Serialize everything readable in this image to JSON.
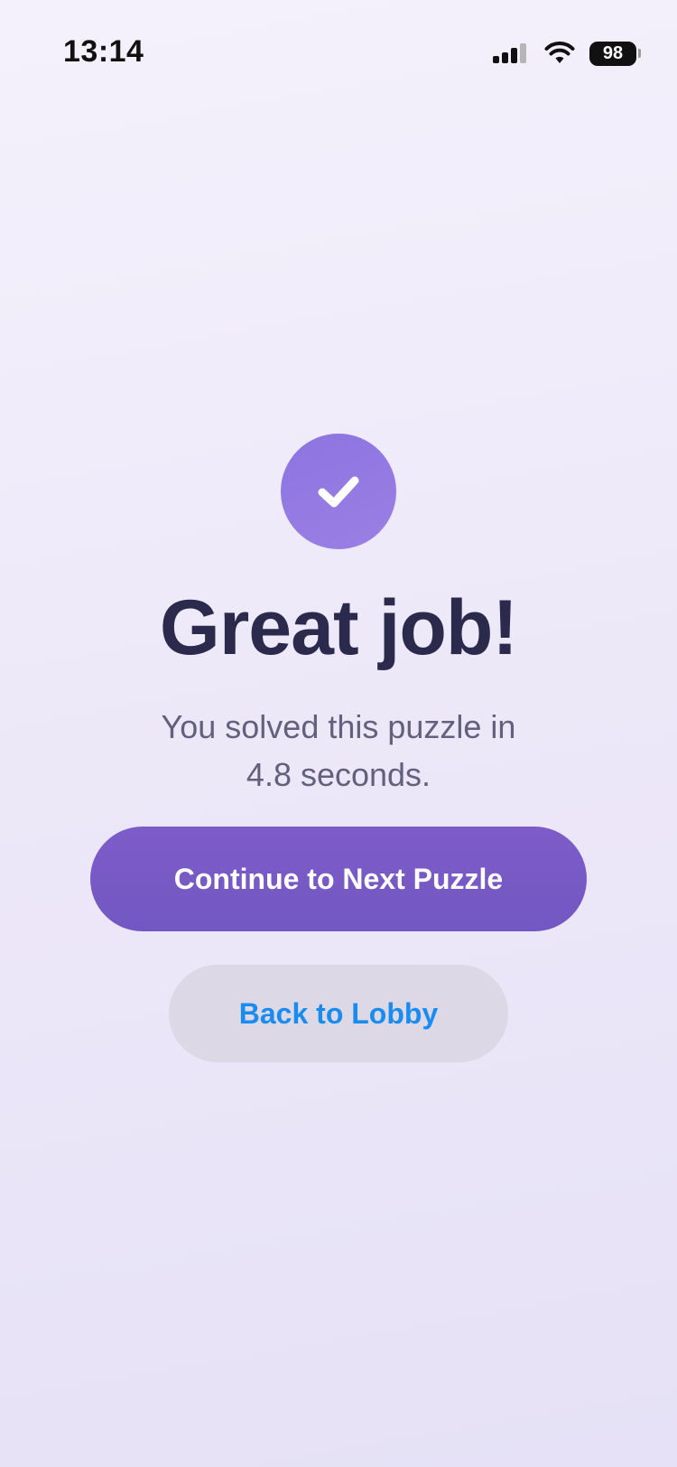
{
  "status_bar": {
    "time": "13:14",
    "battery_level": "98",
    "signal_icon": "cellular-signal-icon",
    "wifi_icon": "wifi-icon",
    "battery_icon": "battery-icon"
  },
  "result": {
    "icon": "checkmark-icon",
    "title": "Great job!",
    "message_line1": "You solved this puzzle in",
    "message_line2": "4.8 seconds."
  },
  "actions": {
    "primary_label": "Continue to Next Puzzle",
    "secondary_label": "Back to Lobby"
  },
  "colors": {
    "accent": "#7D5CC8",
    "badge": "#9178E0",
    "title": "#2B2A4C",
    "link": "#1A8CF0",
    "secondary_button_bg": "#DCD8E6"
  }
}
